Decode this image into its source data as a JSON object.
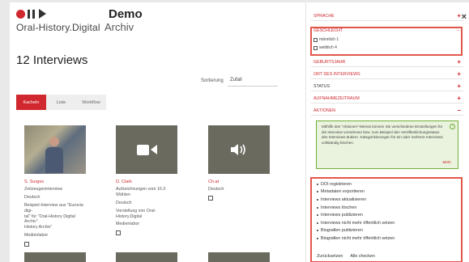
{
  "header": {
    "logo_text": "Oral-History.Digital",
    "project_title": "Demo",
    "project_subtitle": "Archiv"
  },
  "main": {
    "count_title": "12 Interviews",
    "sort_label": "Sortierung",
    "sort_value": "Zufall",
    "view_tabs": [
      {
        "label": "Kacheln",
        "active": true
      },
      {
        "label": "Liste",
        "active": false
      },
      {
        "label": "Workflow",
        "active": false
      }
    ],
    "cards": [
      {
        "thumb": "photo",
        "title": "S.    Surges",
        "lines": [
          "Zeitzeugeninterview",
          "Deutsch",
          "Beispiel-Interview aus \"Eurovia digi-",
          "tal\" für \"Oral-History Digital Archiv\".",
          "History Archiv\"",
          "Medienlabor"
        ]
      },
      {
        "thumb": "video",
        "title": "D.           Clark",
        "lines": [
          "Aufzeichnungen vom 16.3 Wählen",
          "Deutsch",
          "Vorstellung von Oral-History.Digital",
          "Medienlabor"
        ]
      },
      {
        "thumb": "audio",
        "title": "Ch.at",
        "lines": [
          "Deutsch"
        ]
      }
    ]
  },
  "sidebar": {
    "close_label": "×",
    "facets_top": [
      {
        "label": "Sprache",
        "sign": "+",
        "dark": false
      }
    ],
    "sex_facet": {
      "label": "Geschlecht",
      "sign": "−",
      "options": [
        "männlich 1",
        "weiblich 4"
      ]
    },
    "facets_mid": [
      {
        "label": "Geburtsjahr",
        "sign": "+",
        "dark": false
      },
      {
        "label": "Ort des Interviews",
        "sign": "+",
        "dark": false
      },
      {
        "label": "Status",
        "sign": "+",
        "dark": true
      },
      {
        "label": "Aufnahmezeitraum",
        "sign": "+",
        "dark": false
      },
      {
        "label": "Aktionen",
        "sign": "−",
        "dark": false
      }
    ],
    "info_text": "Mithilfe des \"Aktionen\"-Menüs können Sie verschiedene Einstellungen für die Interview vornehmen bzw. zum Beispiel den Veröffentlichungsstatus des Interviews ändern. Kategorisierungen für ein oder mehrere Interviews vollständig löschen.",
    "info_more": "Mehr",
    "actions": [
      "DOI registrieren",
      "Metadaten exportieren",
      "Interviews aktualisieren",
      "Interviews löschen",
      "Interviews publizieren",
      "Interviews nicht mehr öffentlich setzen",
      "Biografien publizieren",
      "Biografien nicht mehr öffentlich setzen"
    ],
    "footer": [
      "Zurücksetzen",
      "Alle checken"
    ]
  },
  "colors": {
    "accent": "#d0282e",
    "highlight": "#e2574c",
    "info_bg": "#eaf3dd",
    "thumb_bg": "#6b6a5f"
  }
}
